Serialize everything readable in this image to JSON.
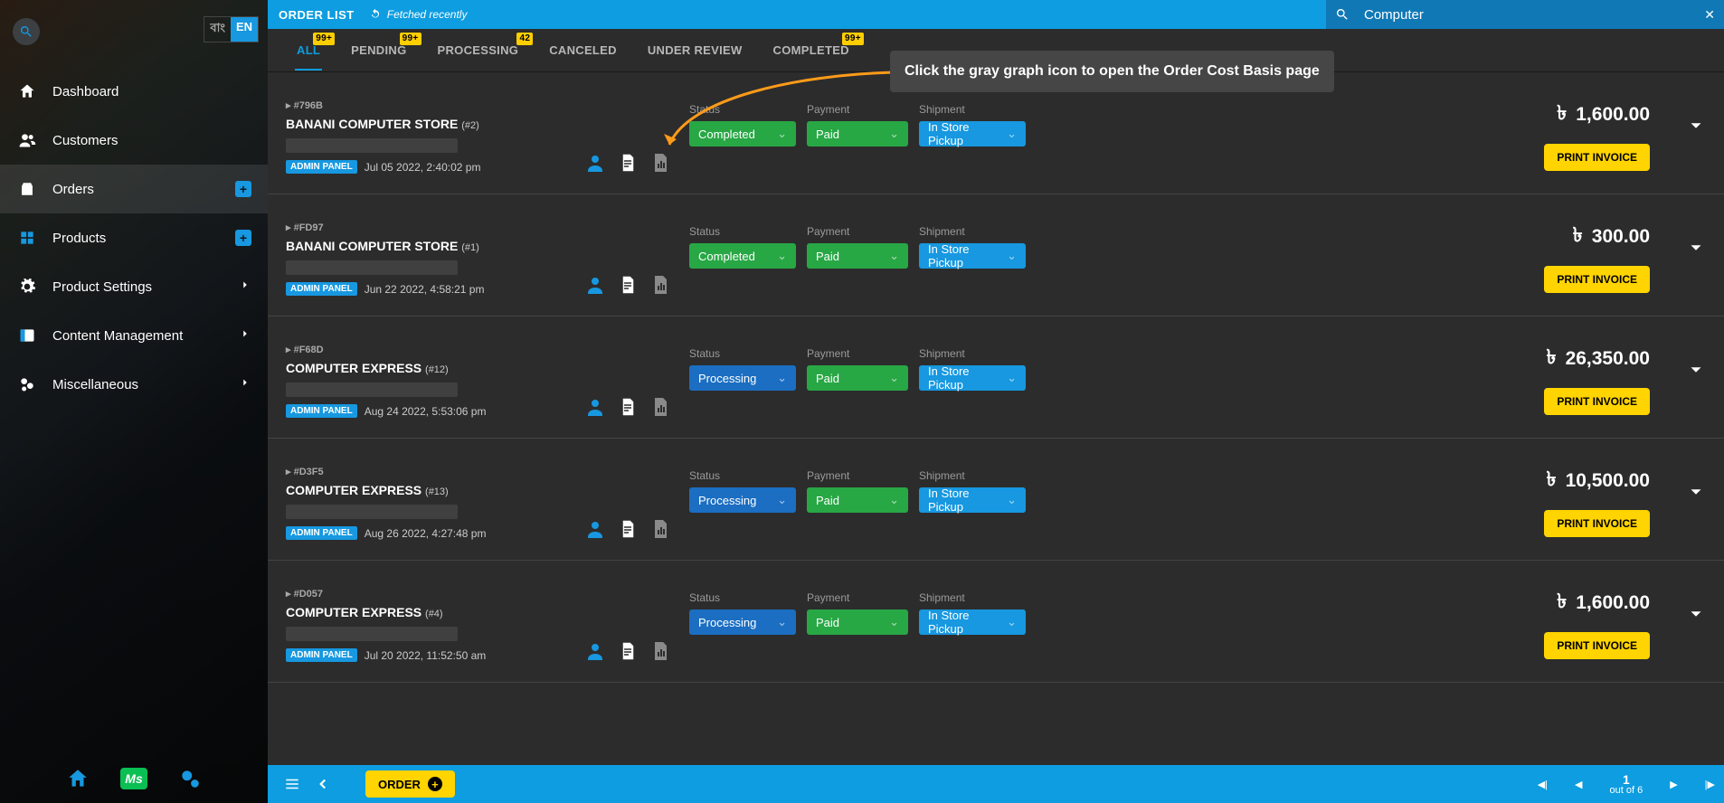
{
  "lang": {
    "bn": "বাং",
    "en": "EN"
  },
  "sidebar": {
    "dashboard": "Dashboard",
    "customers": "Customers",
    "orders": "Orders",
    "products": "Products",
    "product_settings": "Product Settings",
    "content": "Content Management",
    "misc": "Miscellaneous"
  },
  "topbar": {
    "title": "ORDER LIST",
    "refresh": "Fetched recently"
  },
  "search": {
    "value": "Computer"
  },
  "tabs": {
    "all": {
      "label": "ALL",
      "badge": "99+"
    },
    "pending": {
      "label": "PENDING",
      "badge": "99+"
    },
    "processing": {
      "label": "PROCESSING",
      "badge": "42"
    },
    "canceled": {
      "label": "CANCELED"
    },
    "under_review": {
      "label": "UNDER REVIEW"
    },
    "completed": {
      "label": "COMPLETED",
      "badge": "99+"
    }
  },
  "tip": "Click the gray graph icon to open the Order Cost Basis page",
  "headers": {
    "status": "Status",
    "payment": "Payment",
    "shipment": "Shipment"
  },
  "labels": {
    "admin": "ADMIN PANEL",
    "print": "PRINT INVOICE"
  },
  "orders": [
    {
      "id": "#796B",
      "store": "BANANI COMPUTER STORE",
      "store_sub": "(#2)",
      "date": "Jul 05 2022, 2:40:02 pm",
      "status": "Completed",
      "status_c": "green",
      "payment": "Paid",
      "shipment": "In Store Pickup",
      "amount": "1,600.00"
    },
    {
      "id": "#FD97",
      "store": "BANANI COMPUTER STORE",
      "store_sub": "(#1)",
      "date": "Jun 22 2022, 4:58:21 pm",
      "status": "Completed",
      "status_c": "green",
      "payment": "Paid",
      "shipment": "In Store Pickup",
      "amount": "300.00"
    },
    {
      "id": "#F68D",
      "store": "COMPUTER EXPRESS",
      "store_sub": "(#12)",
      "date": "Aug 24 2022, 5:53:06 pm",
      "status": "Processing",
      "status_c": "blue",
      "payment": "Paid",
      "shipment": "In Store Pickup",
      "amount": "26,350.00"
    },
    {
      "id": "#D3F5",
      "store": "COMPUTER EXPRESS",
      "store_sub": "(#13)",
      "date": "Aug 26 2022, 4:27:48 pm",
      "status": "Processing",
      "status_c": "blue",
      "payment": "Paid",
      "shipment": "In Store Pickup",
      "amount": "10,500.00"
    },
    {
      "id": "#D057",
      "store": "COMPUTER EXPRESS",
      "store_sub": "(#4)",
      "date": "Jul 20 2022, 11:52:50 am",
      "status": "Processing",
      "status_c": "blue",
      "payment": "Paid",
      "shipment": "In Store Pickup",
      "amount": "1,600.00"
    }
  ],
  "bottom": {
    "order": "ORDER",
    "page": "1",
    "total": "out of 6"
  }
}
